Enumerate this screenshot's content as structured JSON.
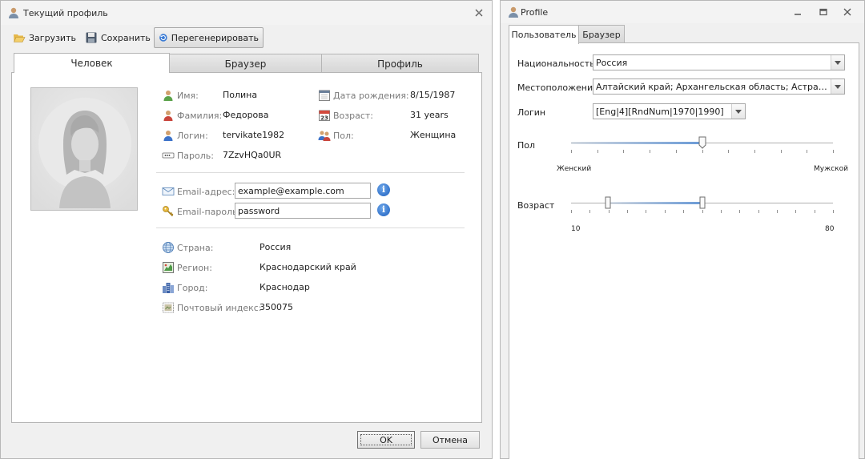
{
  "left_window": {
    "title": "Текущий профиль",
    "toolbar": {
      "load_label": "Загрузить",
      "save_label": "Сохранить",
      "regenerate_label": "Перегенерировать"
    },
    "tabs": [
      {
        "label": "Человек",
        "active": true
      },
      {
        "label": "Браузер",
        "active": false
      },
      {
        "label": "Профиль",
        "active": false
      }
    ],
    "person": {
      "first_name_label": "Имя:",
      "first_name": "Полина",
      "last_name_label": "Фамилия:",
      "last_name": "Федорова",
      "login_label": "Логин:",
      "login": "tervikate1982",
      "password_label": "Пароль:",
      "password": "7ZzvHQa0UR",
      "birth_label": "Дата рождения:",
      "birth": "8/15/1987",
      "age_label": "Возраст:",
      "age": "31 years",
      "sex_label": "Пол:",
      "sex": "Женщина"
    },
    "email": {
      "address_label": "Email-адрес:",
      "address_value": "example@example.com",
      "password_label": "Email-пароль:",
      "password_value": "password"
    },
    "location": {
      "country_label": "Страна:",
      "country": "Россия",
      "region_label": "Регион:",
      "region": "Краснодарский край",
      "city_label": "Город:",
      "city": "Краснодар",
      "zip_label": "Почтовый индекс:",
      "zip": "350075"
    },
    "buttons": {
      "ok": "OK",
      "cancel": "Отмена"
    }
  },
  "right_window": {
    "title": "Profile",
    "tabs": [
      {
        "label": "Пользователь",
        "active": true
      },
      {
        "label": "Браузер",
        "active": false
      }
    ],
    "nationality_label": "Национальность",
    "nationality_value": "Россия",
    "location_label": "Местоположение",
    "location_value": "Алтайский край; Архангельская область; Астраханск...",
    "login_label": "Логин",
    "login_value": "[Eng|4][RndNum|1970|1990]",
    "sex_slider": {
      "label": "Пол",
      "min_label": "Женский",
      "max_label": "Мужской",
      "value": 0.5
    },
    "age_slider": {
      "label": "Возраст",
      "min_label": "10",
      "max_label": "80",
      "range_low": 0.14,
      "range_high": 0.5
    }
  },
  "colors": {
    "window_bg": "#f0f0f0",
    "panel_bg": "#ffffff",
    "label_gray": "#7a7a7a",
    "info_blue": "#1c5fbf",
    "slider_fill": "#6a9ad6"
  }
}
